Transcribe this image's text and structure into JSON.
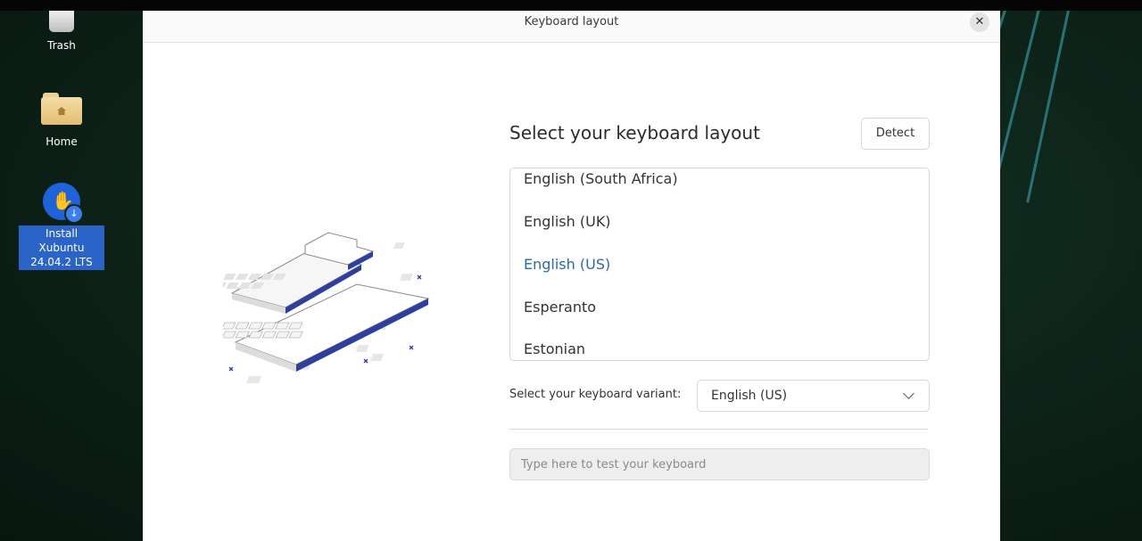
{
  "desktop": {
    "icons": [
      {
        "label": "Trash",
        "icon": "trash-icon"
      },
      {
        "label": "Home",
        "icon": "home-folder-icon"
      },
      {
        "label_line1": "Install Xubuntu",
        "label_line2": "24.04.2 LTS",
        "icon": "installer-icon"
      }
    ]
  },
  "window": {
    "title": "Keyboard layout",
    "close_icon": "close-icon"
  },
  "main": {
    "heading": "Select your keyboard layout",
    "detect_label": "Detect",
    "layouts": [
      {
        "label": "English (South Africa)",
        "selected": false
      },
      {
        "label": "English (UK)",
        "selected": false
      },
      {
        "label": "English (US)",
        "selected": true
      },
      {
        "label": "Esperanto",
        "selected": false
      },
      {
        "label": "Estonian",
        "selected": false
      }
    ],
    "variant_label": "Select your keyboard variant:",
    "variant_value": "English (US)",
    "test_placeholder": "Type here to test your keyboard"
  },
  "colors": {
    "accent": "#2c6aa0",
    "illustration_accent": "#2f3f9e",
    "desktop_background": "#0d2219"
  }
}
